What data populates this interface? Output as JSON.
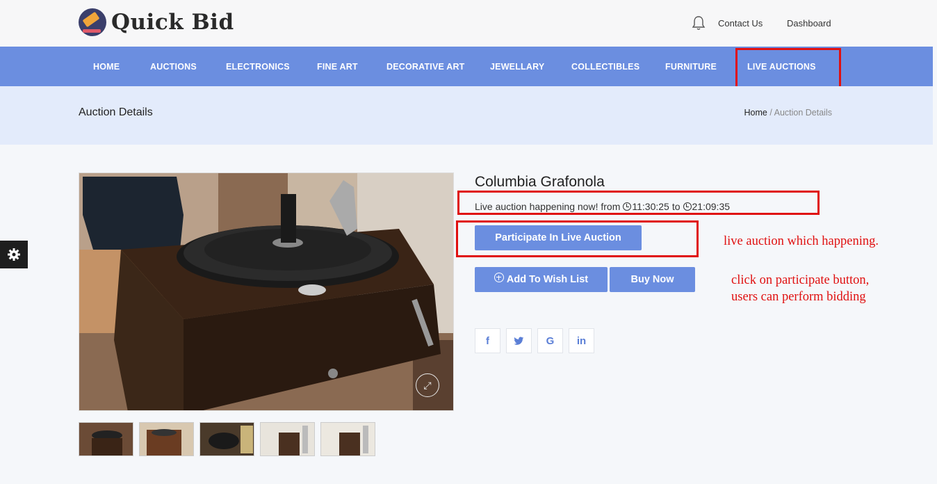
{
  "brand": {
    "name": "Quick Bid"
  },
  "header": {
    "contact_label": "Contact Us",
    "dashboard_label": "Dashboard"
  },
  "nav": {
    "items": [
      "HOME",
      "AUCTIONS",
      "ELECTRONICS",
      "FINE ART",
      "DECORATIVE ART",
      "JEWELLARY",
      "COLLECTIBLES",
      "FURNITURE",
      "LIVE AUCTIONS"
    ],
    "active": "LIVE AUCTIONS"
  },
  "breadcrumb": {
    "title": "Auction Details",
    "home": "Home",
    "current": "/ Auction Details"
  },
  "product": {
    "title": "Columbia Grafonola",
    "live_prefix": "Live auction happening now! from",
    "start_time": "11:30:25",
    "to_word": "to",
    "end_time": "21:09:35",
    "participate_label": "Participate In Live Auction",
    "wishlist_label": "Add To Wish List",
    "buy_label": "Buy Now",
    "thumbnail_count": 5
  },
  "social": [
    "f",
    "twitter-icon",
    "G",
    "in"
  ],
  "annotations": {
    "note1": "live auction which happening.",
    "note2_line1": "click on participate button,",
    "note2_line2": "users can perform bidding"
  },
  "colors": {
    "primary": "#6b8ee0",
    "highlight": "#e01010",
    "crumb_bg": "#e3ebfb"
  }
}
